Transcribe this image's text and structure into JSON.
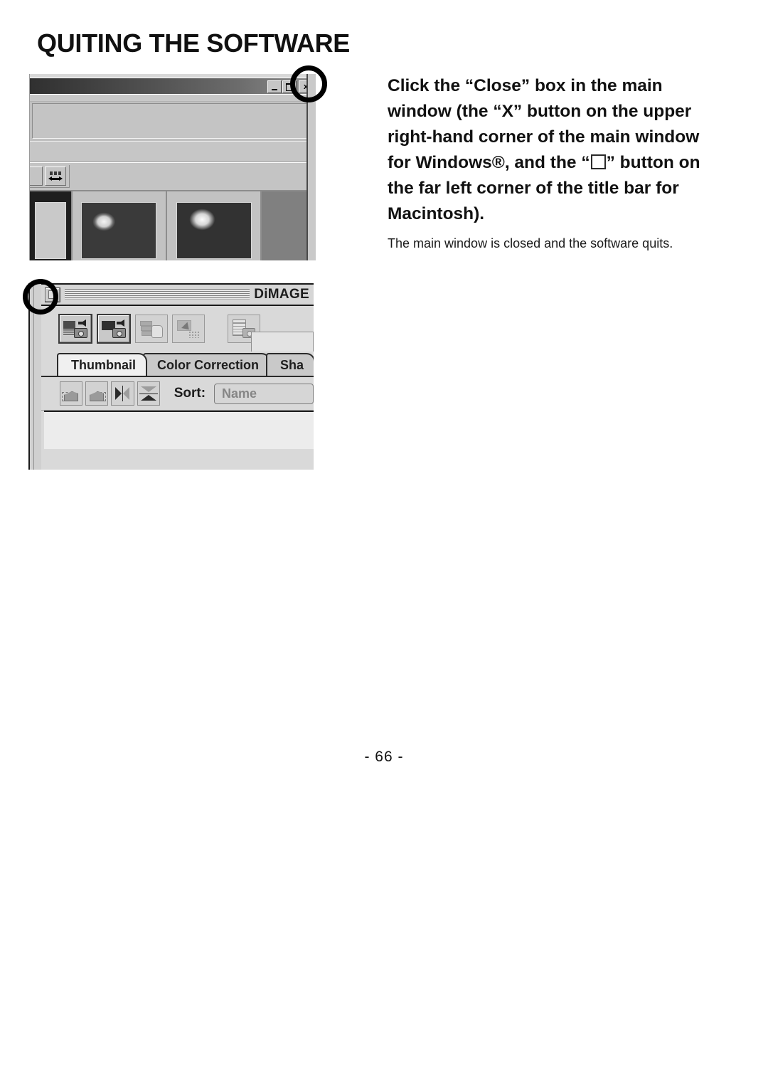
{
  "page": {
    "title": "QUITING THE SOFTWARE",
    "number": "- 66 -"
  },
  "instruction": {
    "lead_1": "Click the “Close” box in the main window (the “X” button on the upper right-hand corner of the main window for Windows®, and the “",
    "lead_2": "” button on the far left corner of the title bar for Macintosh).",
    "result": "The main window is closed and the software quits."
  },
  "windows_screenshot": {
    "titlebar": {
      "minimize_label": "",
      "maximize_label": "",
      "close_label": "x"
    },
    "toolbar": {
      "resize_button_name": "thumbnail-size-button"
    },
    "thumbnails": [
      {
        "name": "thumbnail-selected",
        "state": "selected"
      },
      {
        "name": "thumbnail-flowers-1",
        "state": "normal"
      },
      {
        "name": "thumbnail-flowers-2",
        "state": "normal"
      },
      {
        "name": "thumbnail-empty",
        "state": "empty"
      }
    ]
  },
  "mac_screenshot": {
    "titlebar": {
      "close_box_name": "mac-close-box",
      "title": "DiMAGE"
    },
    "toolbar_buttons": [
      {
        "name": "load-from-camera-button",
        "enabled": true
      },
      {
        "name": "load-all-from-camera-button",
        "enabled": true
      },
      {
        "name": "save-images-button",
        "enabled": false
      },
      {
        "name": "move-images-button",
        "enabled": false
      },
      {
        "name": "print-index-button",
        "enabled": true
      }
    ],
    "tabs": [
      {
        "label": "Thumbnail",
        "active": true
      },
      {
        "label": "Color Correction",
        "active": false
      },
      {
        "label": "Sha",
        "active": false
      }
    ],
    "sort_buttons": [
      {
        "name": "rotate-left-button"
      },
      {
        "name": "rotate-right-button"
      },
      {
        "name": "flip-horizontal-button"
      },
      {
        "name": "flip-vertical-button"
      }
    ],
    "sort": {
      "label": "Sort:",
      "value": "Name"
    }
  }
}
